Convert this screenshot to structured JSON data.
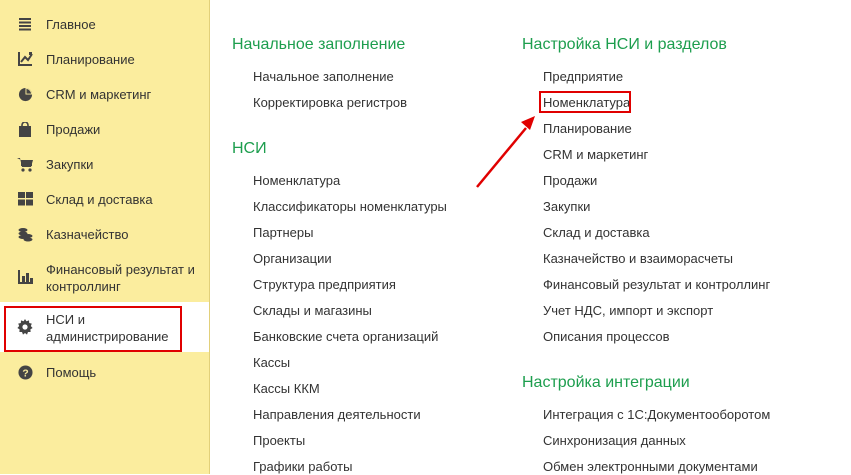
{
  "sidebar": {
    "items": [
      {
        "label": "Главное",
        "icon": "menu-lines-icon"
      },
      {
        "label": "Планирование",
        "icon": "planning-chart-icon"
      },
      {
        "label": "CRM и маркетинг",
        "icon": "pie-chart-icon"
      },
      {
        "label": "Продажи",
        "icon": "shopping-bag-icon"
      },
      {
        "label": "Закупки",
        "icon": "cart-icon"
      },
      {
        "label": "Склад и доставка",
        "icon": "warehouse-grid-icon"
      },
      {
        "label": "Казначейство",
        "icon": "coins-icon"
      },
      {
        "label": "Финансовый результат и контроллинг",
        "label_line1": "Финансовый результат и",
        "label_line2": "контроллинг",
        "icon": "bar-chart-icon"
      },
      {
        "label": "НСИ и администрирование",
        "label_line1": "НСИ и",
        "label_line2": "администрирование",
        "icon": "gear-icon",
        "active": true
      },
      {
        "label": "Помощь",
        "icon": "help-icon"
      }
    ]
  },
  "left_column": {
    "sections": [
      {
        "title": "Начальное заполнение",
        "links": [
          "Начальное заполнение",
          "Корректировка регистров"
        ]
      },
      {
        "title": "НСИ",
        "links": [
          "Номенклатура",
          "Классификаторы номенклатуры",
          "Партнеры",
          "Организации",
          "Структура предприятия",
          "Склады и магазины",
          "Банковские счета организаций",
          "Кассы",
          "Кассы ККМ",
          "Направления деятельности",
          "Проекты",
          "Графики работы"
        ]
      }
    ]
  },
  "right_column": {
    "sections": [
      {
        "title": "Настройка НСИ и разделов",
        "links": [
          "Предприятие",
          "Номенклатура",
          "Планирование",
          "CRM и маркетинг",
          "Продажи",
          "Закупки",
          "Склад и доставка",
          "Казначейство и взаиморасчеты",
          "Финансовый результат и контроллинг",
          "Учет НДС, импорт и экспорт",
          "Описания процессов"
        ]
      },
      {
        "title": "Настройка интеграции",
        "links": [
          "Интеграция с 1С:Документооборотом",
          "Синхронизация данных",
          "Обмен электронными документами"
        ]
      }
    ]
  },
  "colors": {
    "sidebar_bg": "#fbed9e",
    "section_title": "#1d9e4e",
    "highlight": "#e00000",
    "text": "#333333"
  }
}
